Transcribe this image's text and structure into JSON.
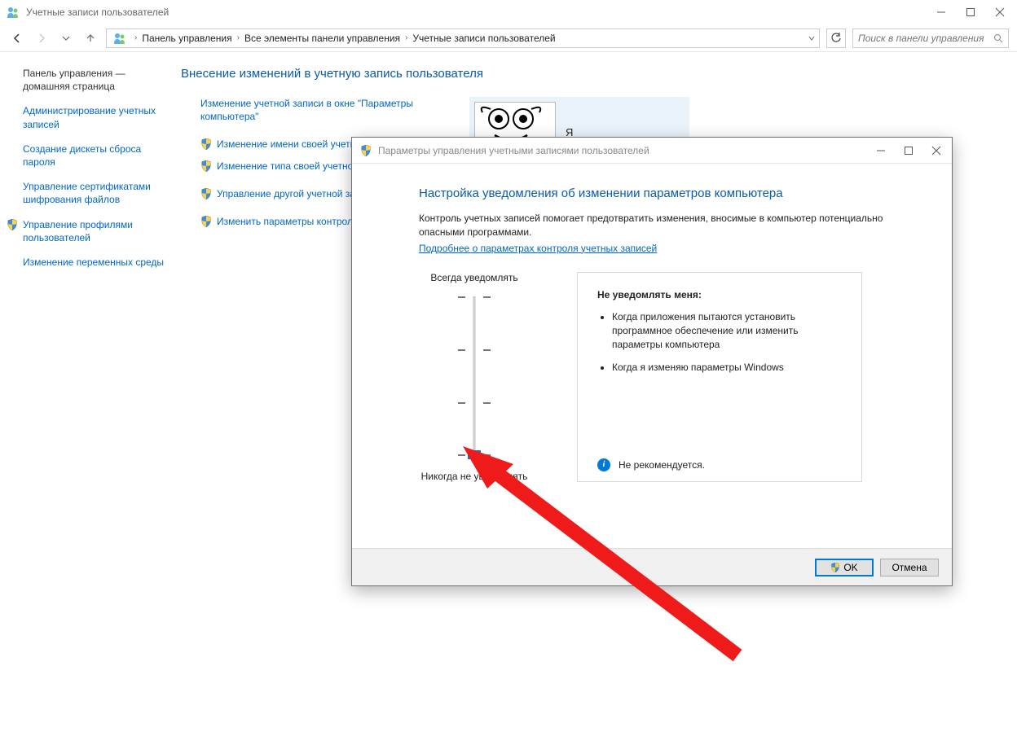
{
  "window": {
    "title": "Учетные записи пользователей"
  },
  "nav": {
    "breadcrumb": [
      "Панель управления",
      "Все элементы панели управления",
      "Учетные записи пользователей"
    ],
    "search_placeholder": "Поиск в панели управления"
  },
  "sidebar": {
    "home": "Панель управления — домашняя страница",
    "links": [
      {
        "label": "Администрирование учетных записей",
        "shield": false
      },
      {
        "label": "Создание дискеты сброса пароля",
        "shield": false
      },
      {
        "label": "Управление сертификатами шифрования файлов",
        "shield": false
      },
      {
        "label": "Управление профилями пользователей",
        "shield": true
      },
      {
        "label": "Изменение переменных среды",
        "shield": false
      }
    ]
  },
  "content": {
    "title": "Внесение изменений в учетную запись пользователя",
    "links1": [
      "Изменение учетной записи в окне \"Параметры компьютера\""
    ],
    "links2": [
      "Изменение имени своей учетной",
      "Изменение типа своей учетной з"
    ],
    "links3": [
      "Управление другой учетной запи"
    ],
    "links4": [
      "Изменить параметры контроля учетн"
    ],
    "user": {
      "name": "Я"
    }
  },
  "dialog": {
    "title": "Параметры управления учетными записями пользователей",
    "heading": "Настройка уведомления об изменении параметров компьютера",
    "desc": "Контроль учетных записей помогает предотвратить изменения, вносимые в компьютер потенциально опасными программами.",
    "link": "Подробнее о параметрах контроля учетных записей",
    "slider_top": "Всегда уведомлять",
    "slider_bottom": "Никогда не уведомлять",
    "slider_level": 0,
    "panel_title": "Не уведомлять меня:",
    "panel_items": [
      "Когда приложения пытаются установить программное обеспечение или изменить параметры компьютера",
      "Когда я изменяю параметры Windows"
    ],
    "panel_note": "Не рекомендуется.",
    "ok": "OK",
    "cancel": "Отмена"
  }
}
